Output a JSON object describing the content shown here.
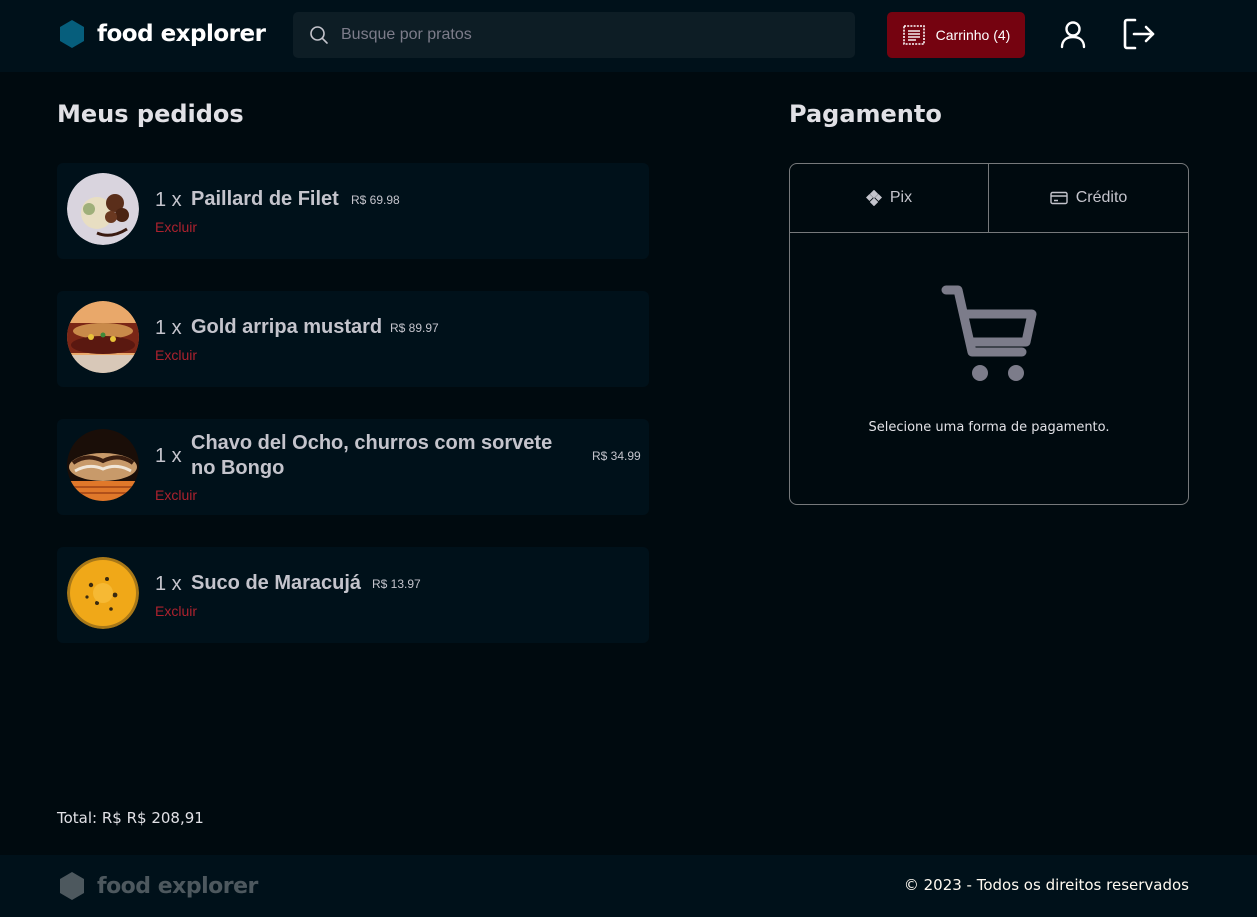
{
  "header": {
    "logo_text": "food explorer",
    "search_placeholder": "Busque por pratos",
    "cart_label": "Carrinho (4)"
  },
  "orders": {
    "title": "Meus pedidos",
    "items": [
      {
        "qty": "1 x",
        "name": "Paillard de Filet",
        "price": "R$ 69.98",
        "delete_label": "Excluir"
      },
      {
        "qty": "1 x",
        "name": "Gold arripa mustard",
        "price": "R$ 89.97",
        "delete_label": "Excluir"
      },
      {
        "qty": "1 x",
        "name": "Chavo del Ocho, churros com sorvete no Bongo",
        "price": "R$ 34.99",
        "delete_label": "Excluir"
      },
      {
        "qty": "1 x",
        "name": "Suco de Maracujá",
        "price": "R$ 13.97",
        "delete_label": "Excluir"
      }
    ],
    "total": "Total: R$ R$ 208,91"
  },
  "payment": {
    "title": "Pagamento",
    "tabs": [
      {
        "label": "Pix",
        "icon": "pix-icon"
      },
      {
        "label": "Crédito",
        "icon": "credit-card-icon"
      }
    ],
    "message": "Selecione uma forma de pagamento.",
    "icon": "cart-icon"
  },
  "footer": {
    "logo_text": "food explorer",
    "copyright": "© 2023 - Todos os direitos reservados"
  },
  "colors": {
    "background": "#000A0F",
    "header": "#00111A",
    "cart_button": "#750310",
    "delete_link": "#AB222E",
    "logo_hex": "#065E7C"
  }
}
